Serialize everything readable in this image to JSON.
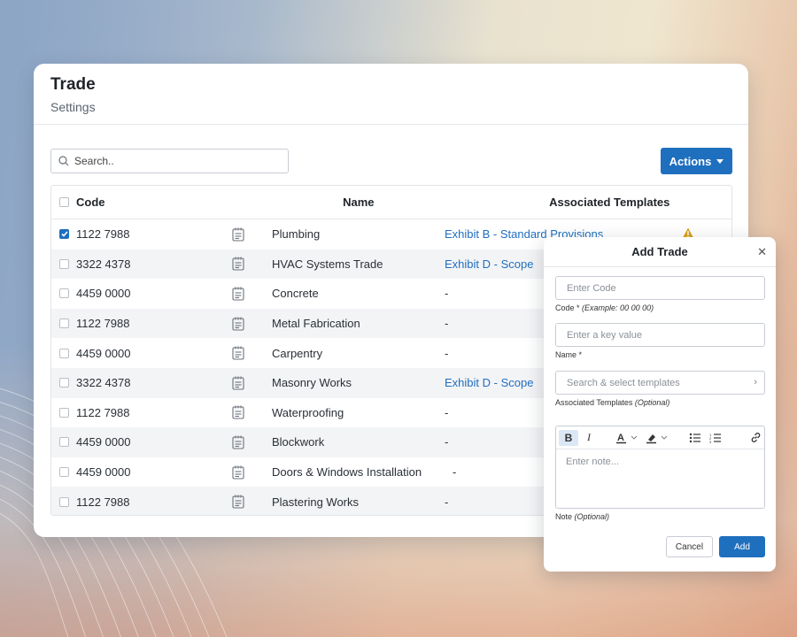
{
  "page": {
    "title": "Trade",
    "subtitle": "Settings"
  },
  "toolbar": {
    "search_placeholder": "Search..",
    "actions_label": "Actions"
  },
  "table": {
    "columns": {
      "code": "Code",
      "name": "Name",
      "templates": "Associated Templates"
    },
    "rows": [
      {
        "checked": true,
        "code": "1122 7988",
        "name": "Plumbing",
        "template": "Exhibit B - Standard Provisions",
        "warning": true
      },
      {
        "checked": false,
        "code": "3322 4378",
        "name": "HVAC Systems Trade",
        "template": "Exhibit D - Scope"
      },
      {
        "checked": false,
        "code": "4459 0000",
        "name": "Concrete",
        "template": "-"
      },
      {
        "checked": false,
        "code": "1122 7988",
        "name": "Metal Fabrication",
        "template": "-"
      },
      {
        "checked": false,
        "code": "4459 0000",
        "name": "Carpentry",
        "template": "-"
      },
      {
        "checked": false,
        "code": "3322 4378",
        "name": "Masonry Works",
        "template": "Exhibit D - Scope"
      },
      {
        "checked": false,
        "code": "1122 7988",
        "name": "Waterproofing",
        "template": "-"
      },
      {
        "checked": false,
        "code": "4459 0000",
        "name": "Blockwork",
        "template": "-"
      },
      {
        "checked": false,
        "code": "4459 0000",
        "name": "Doors & Windows Installation",
        "template": "-"
      },
      {
        "checked": false,
        "code": "1122 7988",
        "name": "Plastering Works",
        "template": "-"
      }
    ]
  },
  "modal": {
    "title": "Add Trade",
    "code_placeholder": "Enter Code",
    "code_label": "Code *",
    "code_example": "(Example: 00 00 00)",
    "name_placeholder": "Enter a key value",
    "name_label": "Name *",
    "templates_placeholder": "Search & select templates",
    "templates_label": "Associated Templates",
    "optional": "(Optional)",
    "note_placeholder": "Enter note...",
    "note_label": "Note",
    "editor_tools": {
      "bold": "B",
      "italic": "I",
      "text_color": "A"
    },
    "cancel_label": "Cancel",
    "add_label": "Add"
  },
  "colors": {
    "accent": "#1f6fbf",
    "warning": "#d9a21b",
    "row_alt": "#f3f4f6"
  }
}
